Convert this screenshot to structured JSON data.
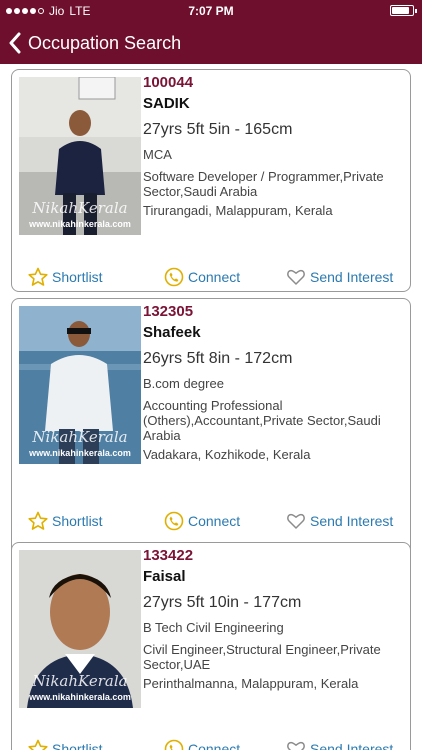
{
  "status_bar": {
    "carrier": "Jio",
    "network": "LTE",
    "time": "7:07 PM",
    "battery_level": 0.85
  },
  "nav": {
    "title": "Occupation Search"
  },
  "actions": {
    "shortlist": "Shortlist",
    "connect": "Connect",
    "send_interest": "Send Interest"
  },
  "watermark": {
    "logo": "NikahKerala",
    "url": "www.nikahinkerala.com"
  },
  "profiles": [
    {
      "id": "100044",
      "name": "SADIK",
      "details": "27yrs 5ft 5in - 165cm",
      "education": "MCA",
      "occupation": "Software Developer / Programmer,Private Sector,Saudi Arabia",
      "location": "Tirurangadi, Malappuram, Kerala"
    },
    {
      "id": "132305",
      "name": "Shafeek",
      "details": "26yrs 5ft 8in - 172cm",
      "education": "B.com degree",
      "occupation": "Accounting Professional (Others),Accountant,Private Sector,Saudi Arabia",
      "location": "Vadakara, Kozhikode, Kerala"
    },
    {
      "id": "133422",
      "name": "Faisal",
      "details": "27yrs 5ft 10in - 177cm",
      "education": "B Tech Civil Engineering",
      "occupation": "Civil Engineer,Structural Engineer,Private Sector,UAE",
      "location": "Perinthalmanna, Malappuram, Kerala"
    }
  ]
}
